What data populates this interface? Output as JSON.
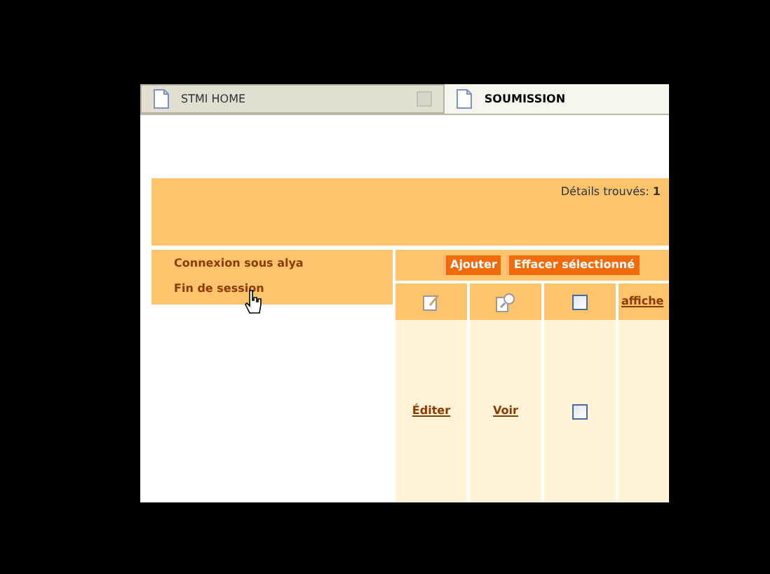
{
  "tabs": [
    {
      "label": "STMI HOME",
      "selected": false
    },
    {
      "label": "SOUMISSION",
      "selected": true
    }
  ],
  "header": {
    "label": "Détails trouvés:",
    "count": "1"
  },
  "menu": [
    "Connexion sous alya",
    "Fin de session"
  ],
  "toolbar": [
    "Ajouter",
    "Effacer sélectionné"
  ],
  "table": {
    "columns": [
      {
        "kind": "edit"
      },
      {
        "kind": "view"
      },
      {
        "kind": "checkbox",
        "checked": false
      },
      {
        "kind": "link",
        "label": "affiche"
      }
    ],
    "rows": [
      {
        "edit": "Éditer",
        "view": "Voir",
        "checked": false
      }
    ]
  }
}
